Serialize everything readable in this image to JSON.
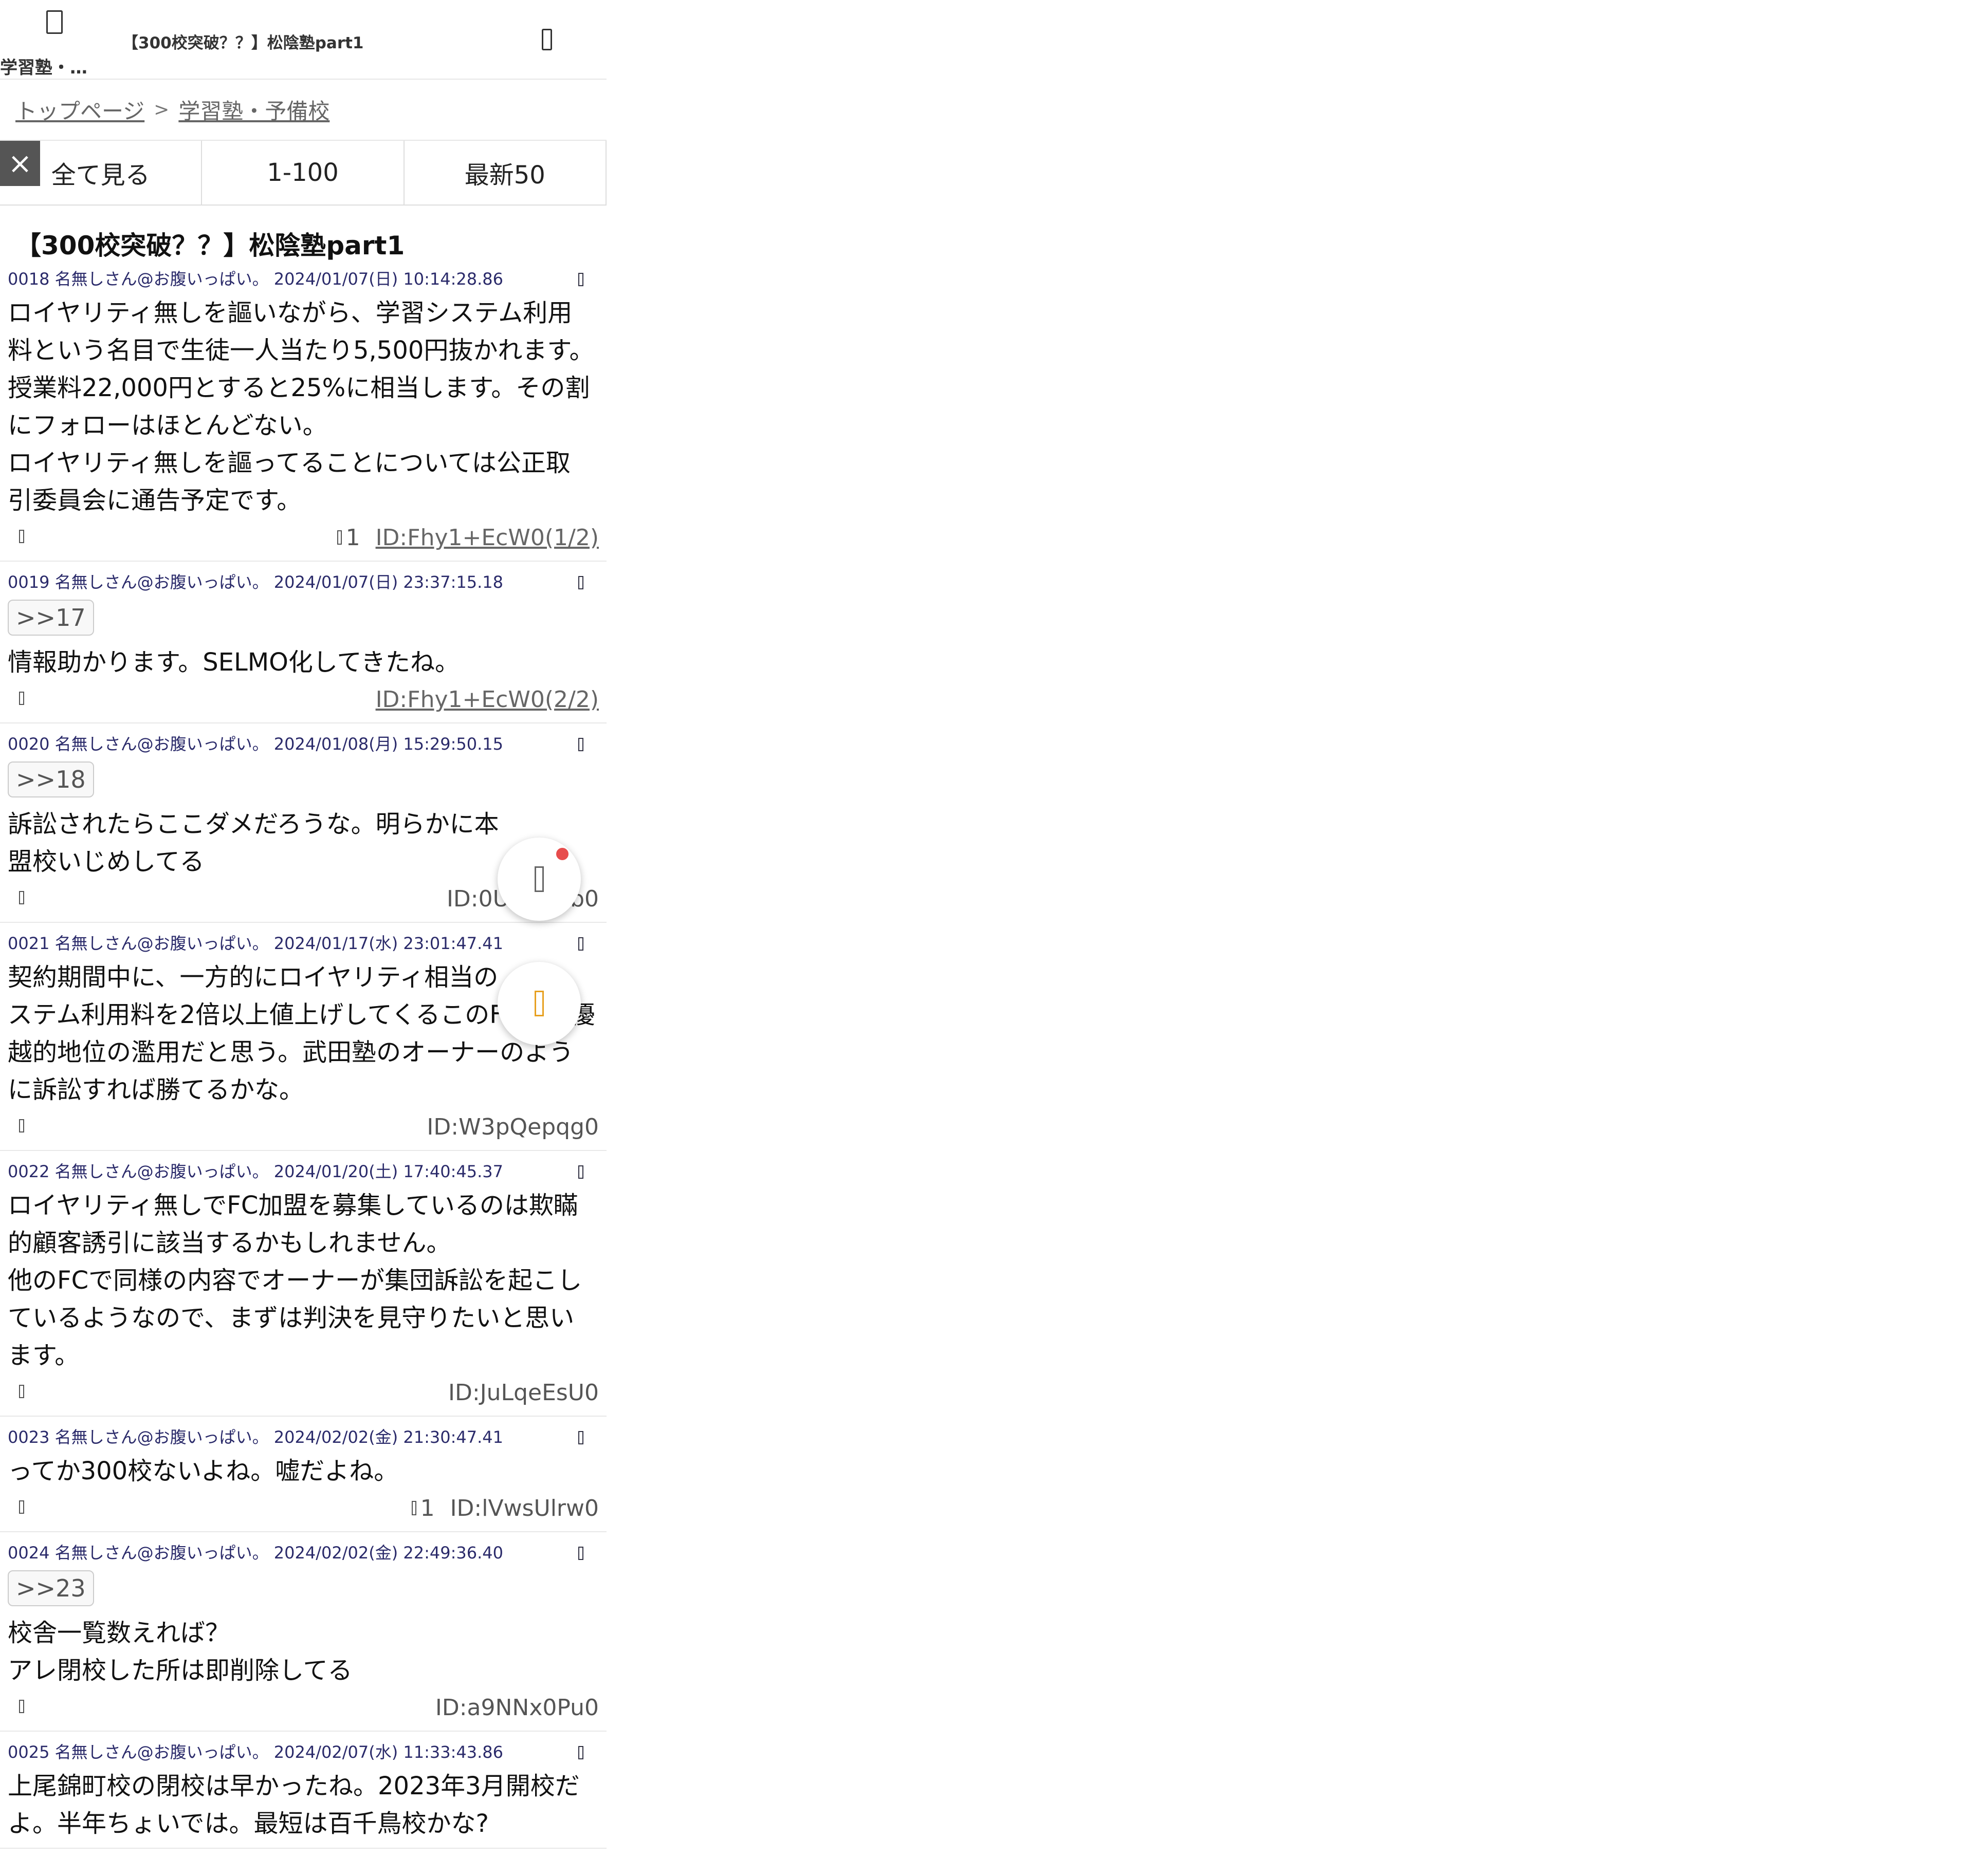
{
  "header": {
    "board": "学習塾・…",
    "title": "【300校突破？？】松陰塾part1"
  },
  "breadcrumb": {
    "top": "トップページ",
    "separator": ">",
    "board": "学習塾・予備校"
  },
  "tabs": [
    "全て見る",
    "1-100",
    "最新50"
  ],
  "thread_title": "【300校突破？？】松陰塾part1",
  "posts": [
    {
      "meta": "0018 名無しさん@お腹いっぱい。 2024/01/07(日) 10:14:28.86",
      "anchor": "",
      "body": "ロイヤリティ無しを謳いながら、学習システム利用\n料という名目で生徒一人当たり5,500円抜かれます。\n授業料22,000円とすると25%に相当します。その割\nにフォローはほとんどない。\nロイヤリティ無しを謳ってることについては公正取\n引委員会に通告予定です。",
      "replies": "1",
      "id": "ID:Fhy1+EcW0(1/2)"
    },
    {
      "meta": "0019 名無しさん@お腹いっぱい。 2024/01/07(日) 23:37:15.18",
      "anchor": ">>17",
      "body": "情報助かります。SELMO化してきたね。",
      "replies": "",
      "id": "ID:Fhy1+EcW0(2/2)"
    },
    {
      "meta": "0020 名無しさん@お腹いっぱい。 2024/01/08(月) 15:29:50.15",
      "anchor": ">>18",
      "body": "訴訟されたらここダメだろうな。明らかに本\n盟校いじめしてる",
      "replies": "",
      "id": "ID:0U/EJQ2b0"
    },
    {
      "meta": "0021 名無しさん@お腹いっぱい。 2024/01/17(水) 23:01:47.41",
      "anchor": "",
      "body": "契約期間中に、一方的にロイヤリティ相当の\nステム利用料を2倍以上値上げしてくるこのFCは、優\n越的地位の濫用だと思う。武田塾のオーナーのよう\nに訴訟すれば勝てるかな。",
      "replies": "",
      "id": "ID:W3pQepqg0"
    },
    {
      "meta": "0022 名無しさん@お腹いっぱい。 2024/01/20(土) 17:40:45.37",
      "anchor": "",
      "body": "ロイヤリティ無しでFC加盟を募集しているのは欺瞞\n的顧客誘引に該当するかもしれません。\n他のFCで同様の内容でオーナーが集団訴訟を起こし\nているようなので、まずは判決を見守りたいと思い\nます。",
      "replies": "",
      "id": "ID:JuLqeEsU0"
    },
    {
      "meta": "0023 名無しさん@お腹いっぱい。 2024/02/02(金) 21:30:47.41",
      "anchor": "",
      "body": "ってか300校ないよね。嘘だよね。",
      "replies": "1",
      "id": "ID:lVwsUlrw0"
    },
    {
      "meta": "0024 名無しさん@お腹いっぱい。 2024/02/02(金) 22:49:36.40",
      "anchor": ">>23",
      "body": "校舎一覧数えれば？\nアレ閉校した所は即削除してる",
      "replies": "",
      "id": "ID:a9NNx0Pu0"
    },
    {
      "meta": "0025 名無しさん@お腹いっぱい。 2024/02/07(水) 11:33:43.86",
      "anchor": "",
      "body": "上尾錦町校の閉校は早かったね。2023年3月開校だ\nよ。半年ちょいでは。最短は百千鳥校かな?",
      "replies": "",
      "id": ""
    }
  ]
}
